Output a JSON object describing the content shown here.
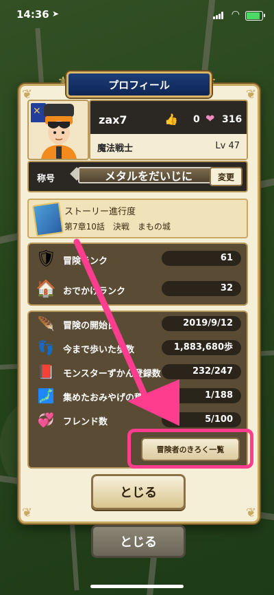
{
  "status_bar": {
    "time": "14:36"
  },
  "dialog": {
    "title": "プロフィール"
  },
  "player": {
    "name": "zax7",
    "likes": "0",
    "hearts": "316",
    "job": "魔法戦士",
    "level": "Lv 47"
  },
  "title_row": {
    "label": "称号",
    "title_name": "メタルをだいじに",
    "change_button": "変更"
  },
  "story": {
    "heading": "ストーリー進行度",
    "progress": "第7章10話　決戦　まもの城"
  },
  "ranks": [
    {
      "label": "冒険ランク",
      "value": "61",
      "icon": "shield-icon"
    },
    {
      "label": "おでかけランク",
      "value": "32",
      "icon": "house-icon"
    }
  ],
  "records": [
    {
      "label": "冒険の開始日",
      "value": "2019/9/12",
      "icon": "wing-icon"
    },
    {
      "label": "今まで歩いた歩数",
      "value": "1,883,680歩",
      "icon": "footprints-icon"
    },
    {
      "label": "モンスターずかん登録数",
      "value": "232/247",
      "icon": "monster-book-icon"
    },
    {
      "label": "集めたおみやげの種類",
      "value": "1/188",
      "icon": "map-icon"
    },
    {
      "label": "フレンド数",
      "value": "5/100",
      "icon": "friends-heart-icon"
    }
  ],
  "records_button": "冒険者のきろく一覧",
  "close_button": "とじる",
  "background_close_button": "とじる",
  "colors": {
    "highlight": "#ff3d8f",
    "panel_frame": "#c9a862",
    "title_plate": "#1c3d78"
  }
}
